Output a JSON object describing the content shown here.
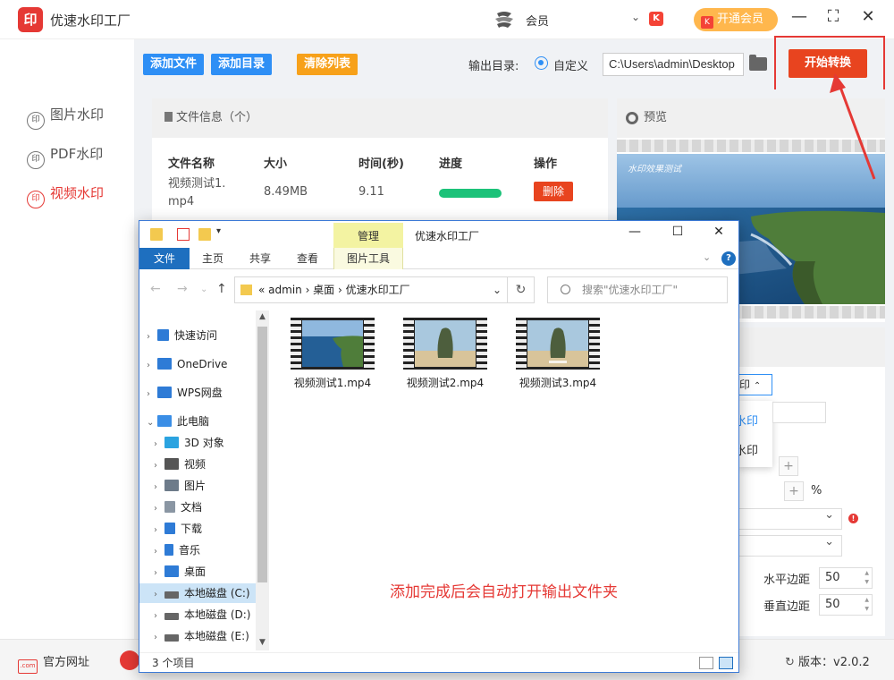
{
  "app": {
    "title": "优速水印工厂",
    "logo_char": "印",
    "member_label": "会员",
    "vip_button": "开通会员",
    "accent": "#e53935"
  },
  "sidebar": {
    "items": [
      {
        "label": "图片水印",
        "icon": "印"
      },
      {
        "label": "PDF水印",
        "icon": "印"
      },
      {
        "label": "视频水印",
        "icon": "印"
      }
    ],
    "active": "视频水印"
  },
  "toolbar": {
    "add_file": "添加文件",
    "add_folder": "添加目录",
    "clear_list": "清除列表",
    "output_label": "输出目录:",
    "custom_label": "自定义",
    "output_path": "C:\\Users\\admin\\Desktop",
    "start": "开始转换"
  },
  "file_panel": {
    "header": "文件信息（个）",
    "columns": [
      "文件名称",
      "大小",
      "时间(秒)",
      "进度",
      "操作"
    ],
    "rows": [
      {
        "name": "视频测试1.\nmp4",
        "size": "8.49MB",
        "time": "9.11",
        "progress": 1.0,
        "action": "删除"
      }
    ]
  },
  "preview": {
    "header": "预览",
    "watermark_text": "水印效果测试"
  },
  "settings": {
    "dropdown_value": "印",
    "dropdown_options": [
      "水印",
      "水印"
    ],
    "percent": "%",
    "h_margin_label": "水平边距",
    "h_margin_value": "50",
    "v_margin_label": "垂直边距",
    "v_margin_value": "50"
  },
  "statusbar": {
    "site": "官方网址",
    "version": "版本：v2.0.2"
  },
  "explorer": {
    "manage_tab": "管理",
    "window_title": "优速水印工厂",
    "ribbon_tabs": [
      "文件",
      "主页",
      "共享",
      "查看",
      "图片工具"
    ],
    "address": "« admin › 桌面 › 优速水印工厂",
    "search_placeholder": "搜索\"优速水印工厂\"",
    "tree": [
      {
        "label": "快速访问",
        "color": "#2e7bd6"
      },
      {
        "label": "OneDrive",
        "color": "#2e7bd6"
      },
      {
        "label": "WPS网盘",
        "color": "#2e7bd6"
      },
      {
        "label": "此电脑",
        "color": "#3a8ee6"
      },
      {
        "label": "3D 对象",
        "color": "#2ba3e0"
      },
      {
        "label": "视频",
        "color": "#555555"
      },
      {
        "label": "图片",
        "color": "#6d7b8a"
      },
      {
        "label": "文档",
        "color": "#8a96a3"
      },
      {
        "label": "下载",
        "color": "#2e7bd6"
      },
      {
        "label": "音乐",
        "color": "#2e7bd6"
      },
      {
        "label": "桌面",
        "color": "#2e7bd6"
      },
      {
        "label": "本地磁盘 (C:)",
        "color": "#666666"
      },
      {
        "label": "本地磁盘 (D:)",
        "color": "#666666"
      },
      {
        "label": "本地磁盘 (E:)",
        "color": "#666666"
      }
    ],
    "files": [
      "视频测试1.mp4",
      "视频测试2.mp4",
      "视频测试3.mp4"
    ],
    "note": "添加完成后会自动打开输出文件夹",
    "status": "3 个项目"
  }
}
